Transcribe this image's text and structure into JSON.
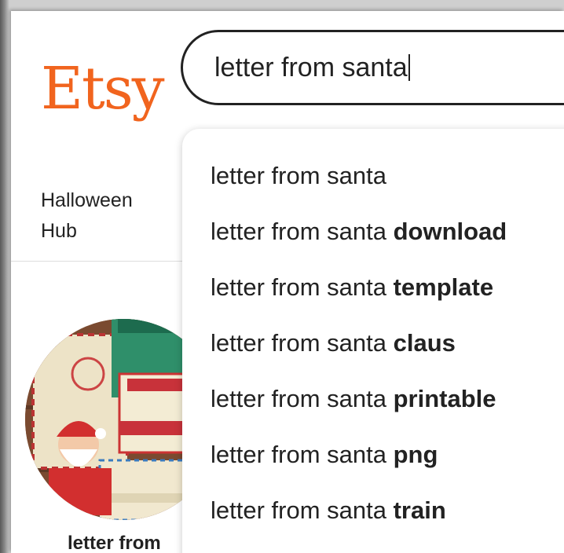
{
  "header": {
    "logo_text": "Etsy",
    "search_value": "letter from santa"
  },
  "nav": {
    "category_line1": "Halloween",
    "category_line2": "Hub"
  },
  "product": {
    "label": "letter from"
  },
  "suggestions": {
    "base": "letter from santa",
    "items": [
      {
        "prefix": "letter from santa",
        "suffix": ""
      },
      {
        "prefix": "letter from santa ",
        "suffix": "download"
      },
      {
        "prefix": "letter from santa ",
        "suffix": "template"
      },
      {
        "prefix": "letter from santa ",
        "suffix": "claus"
      },
      {
        "prefix": "letter from santa ",
        "suffix": "printable"
      },
      {
        "prefix": "letter from santa ",
        "suffix": "png"
      },
      {
        "prefix": "letter from santa ",
        "suffix": "train"
      }
    ]
  },
  "colors": {
    "brand": "#f1641e",
    "text": "#222222"
  }
}
